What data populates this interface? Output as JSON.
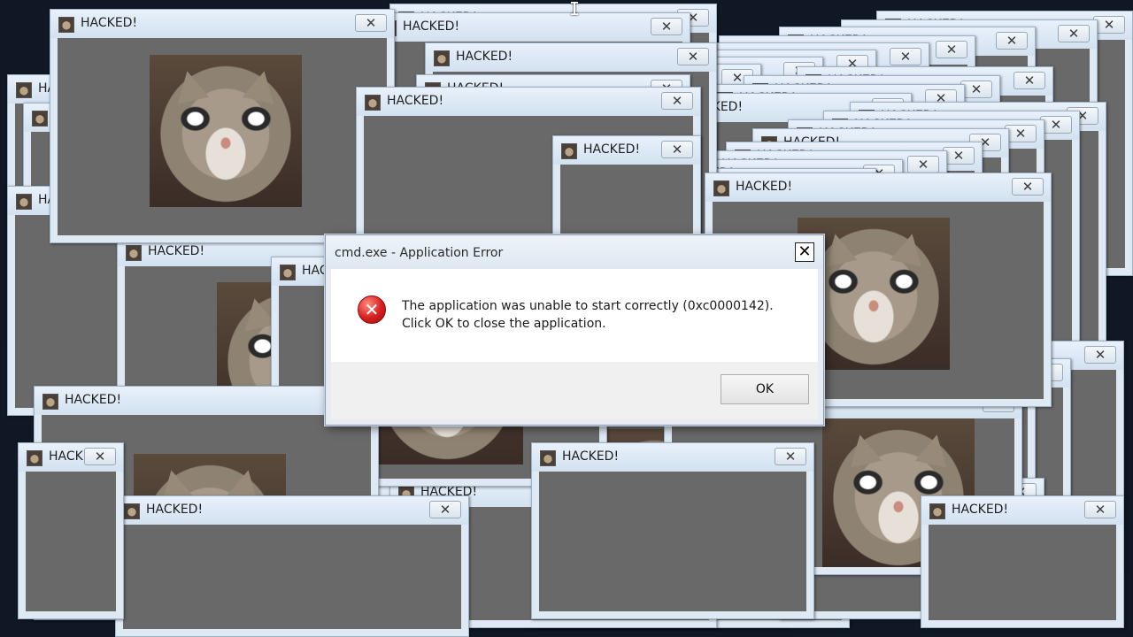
{
  "popup_windows": [
    {
      "title": "HACKED!",
      "close": "✕"
    },
    {
      "title": "HACKED!",
      "close": "✕"
    },
    {
      "title": "HACKED!",
      "close": "✕"
    },
    {
      "title": "HACKED!",
      "close": "✕"
    },
    {
      "title": "HACKED!",
      "close": "✕"
    },
    {
      "title": "HACKED!",
      "close": "✕"
    },
    {
      "title": "HACKED!",
      "close": "✕"
    },
    {
      "title": "HACKED!",
      "close": "✕"
    },
    {
      "title": "HACKED!",
      "close": "✕"
    },
    {
      "title": "HACKED!",
      "close": "✕"
    },
    {
      "title": "HACKED!",
      "close": "✕"
    },
    {
      "title": "HACKED!",
      "close": "✕"
    },
    {
      "title": "HACKED!",
      "close": "✕"
    },
    {
      "title": "HACKED!",
      "close": "✕"
    },
    {
      "title": "HACKED!",
      "close": "✕"
    },
    {
      "title": "HACKED!",
      "close": "✕"
    },
    {
      "title": "HACKED!",
      "close": "✕"
    },
    {
      "title": "HACKED!",
      "close": "✕"
    },
    {
      "title": "HACKED!",
      "close": "✕"
    },
    {
      "title": "HACKED!",
      "close": "✕"
    },
    {
      "title": "HACKED!",
      "close": "✕"
    },
    {
      "title": "HACKED!",
      "close": "✕"
    },
    {
      "title": "HACKED!",
      "close": "✕"
    },
    {
      "title": "HACKED!",
      "close": "✕"
    },
    {
      "title": "HACKED!",
      "close": "✕"
    },
    {
      "title": "HACKED!",
      "close": "✕"
    },
    {
      "title": "HACKED!",
      "close": "✕"
    },
    {
      "title": "HACKED!",
      "close": "✕"
    },
    {
      "title": "HACKED!",
      "close": "✕"
    },
    {
      "title": "HACKED!",
      "close": "✕"
    },
    {
      "title": "HACKED!",
      "close": "✕"
    },
    {
      "title": "HACKED!",
      "close": "✕"
    },
    {
      "title": "HACKED!",
      "close": "✕"
    },
    {
      "title": "HACKED!",
      "close": "✕"
    },
    {
      "title": "HACKED!",
      "close": "✕"
    },
    {
      "title": "HACKED!",
      "close": "✕"
    },
    {
      "title": "HACKED!",
      "close": "✕"
    },
    {
      "title": "HACKED!",
      "close": "✕"
    },
    {
      "title": "HACKED!",
      "close": "✕"
    },
    {
      "title": "HACKED!",
      "close": "✕"
    },
    {
      "title": "HACKED!",
      "close": "✕"
    },
    {
      "title": "HACKED!",
      "close": "✕"
    },
    {
      "title": "HACKED!",
      "close": "✕"
    },
    {
      "title": "HACKED!",
      "close": "✕"
    },
    {
      "title": "HACKED!",
      "close": "✕"
    },
    {
      "title": "HACKED!",
      "close": "✕"
    },
    {
      "title": "HACKED!",
      "close": "✕"
    },
    {
      "title": "HACKED!",
      "close": "✕"
    },
    {
      "title": "HACKED!",
      "close": "✕"
    },
    {
      "title": "HACKED!",
      "close": "✕"
    }
  ],
  "window_icon": "cat-icon",
  "popup_image": "cat-photo",
  "error_dialog": {
    "title": "cmd.exe - Application Error",
    "close_glyph": "✕",
    "icon": "error-icon",
    "icon_glyph": "✕",
    "message": "The application was unable to start correctly (0xc0000142). Click OK to close the application.",
    "ok_label": "OK"
  },
  "cursor_glyph": "I",
  "colors": {
    "desktop": "#101826",
    "window_frame": "#dfe9f4",
    "window_client": "#696969",
    "error_red": "#d61f1f"
  }
}
